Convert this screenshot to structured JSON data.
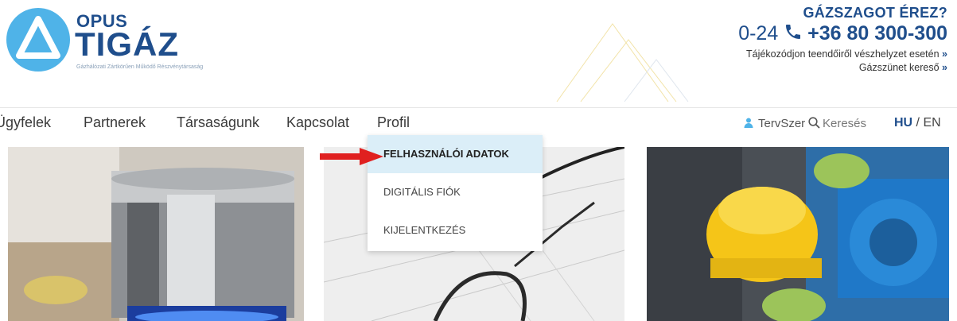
{
  "logo": {
    "brand_top": "OPUS",
    "brand_main": "TIGÁZ",
    "subtitle": "Gázhálózati Zártkörűen Működő Részvénytársaság"
  },
  "emergency": {
    "title": "GÁZSZAGOT ÉREZ?",
    "hours": "0-24",
    "phone": "+36 80 300-300",
    "link1": "Tájékozódjon teendőiről vészhelyzet esetén",
    "link2": "Gázszünet kereső",
    "link_arrow": "»"
  },
  "nav": {
    "items": [
      "Ügyfelek",
      "Partnerek",
      "Társaságunk",
      "Kapcsolat",
      "Profil"
    ],
    "user": "TervSzer",
    "search": "Keresés",
    "lang_active": "HU",
    "lang_sep": " / ",
    "lang_other": "EN"
  },
  "dropdown": {
    "items": [
      "FELHASZNÁLÓI ADATOK",
      "DIGITÁLIS FIÓK",
      "KIJELENTKEZÉS"
    ]
  },
  "colors": {
    "brand_blue": "#1f4e8c",
    "logo_cyan": "#4fb3e8",
    "highlight": "#dbeef8",
    "arrow_red": "#e02020"
  },
  "icons": {
    "phone": "phone-icon",
    "user": "user-icon",
    "search": "search-icon"
  }
}
